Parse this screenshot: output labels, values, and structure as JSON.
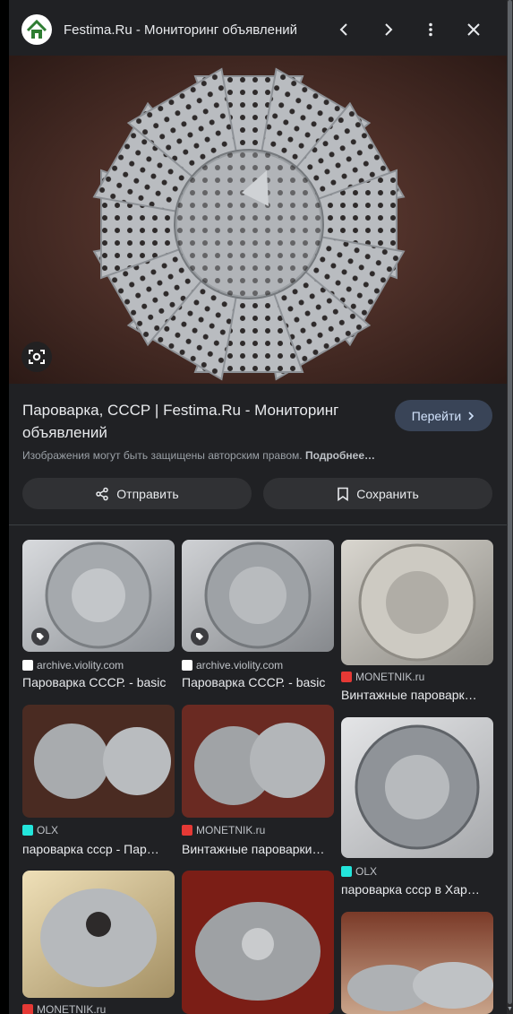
{
  "header": {
    "title": "Festima.Ru - Мониторинг объявлений",
    "icons": [
      "home-logo-icon",
      "chevron-left-icon",
      "chevron-right-icon",
      "more-vert-icon",
      "close-icon"
    ]
  },
  "result": {
    "title": "Пароварка, СССР | Festima.Ru - Мониторинг объявлений",
    "visit_label": "Перейти",
    "copyright_text": "Изображения могут быть защищены авторским правом.",
    "copyright_more": "Подробнее…"
  },
  "actions": {
    "share_label": "Отправить",
    "save_label": "Сохранить"
  },
  "related": [
    {
      "source": "archive.violity.com",
      "caption": "Пароварка СССР. - basic",
      "favicon_color": "#ffffff"
    },
    {
      "source": "archive.violity.com",
      "caption": "Пароварка СССР. - basic",
      "favicon_color": "#ffffff"
    },
    {
      "source": "MONETNIK.ru",
      "caption": "Винтажные пароварк…",
      "favicon_color": "#e53935"
    },
    {
      "source": "OLX",
      "caption": "пароварка ссср - Паро…",
      "favicon_color": "#23e5db"
    },
    {
      "source": "MONETNIK.ru",
      "caption": "Винтажные пароварки…",
      "favicon_color": "#e53935"
    },
    {
      "source": "OLX",
      "caption": "пароварка ссср в Хар…",
      "favicon_color": "#23e5db"
    },
    {
      "source": "MONETNIK.ru",
      "caption": "",
      "favicon_color": "#e53935"
    }
  ]
}
